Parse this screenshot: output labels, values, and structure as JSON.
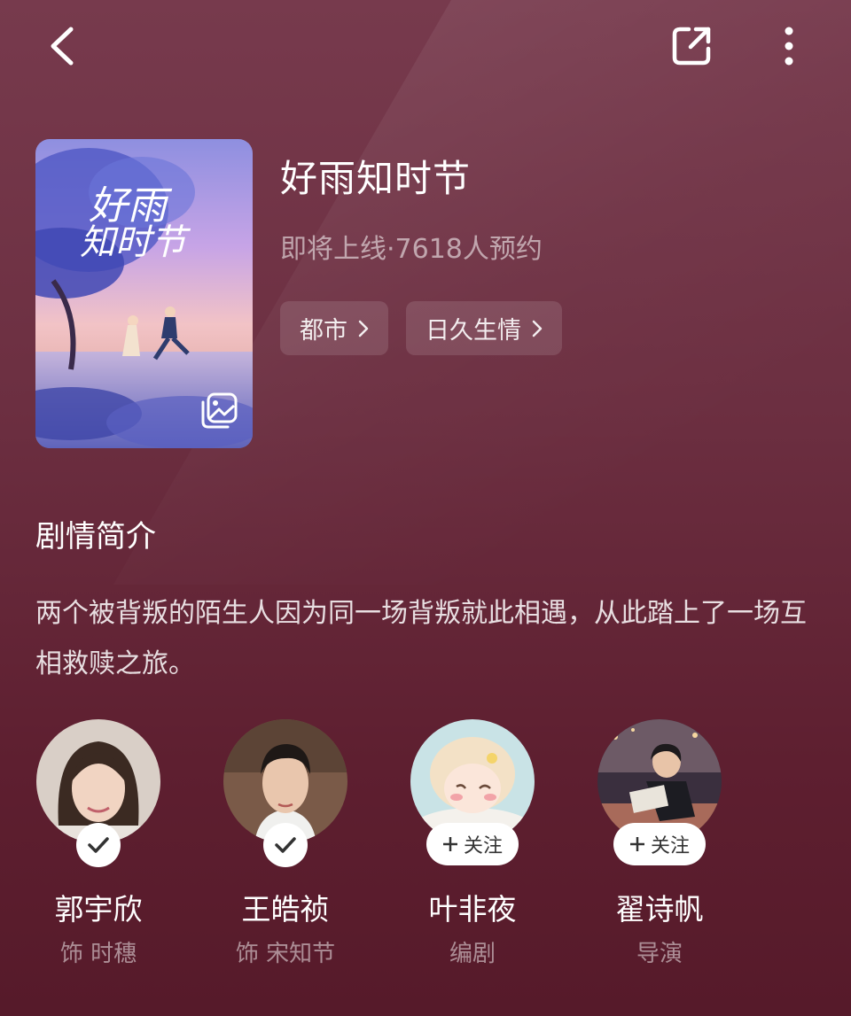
{
  "header": {
    "back_icon": "chevron-left-icon",
    "share_icon": "share-external-icon",
    "more_icon": "more-vertical-icon"
  },
  "poster": {
    "art_title_text": "好雨知时节",
    "gallery_icon": "gallery-icon"
  },
  "show": {
    "title": "好雨知时节",
    "meta": "即将上线·7618人预约",
    "tags": [
      {
        "label": "都市"
      },
      {
        "label": "日久生情"
      }
    ]
  },
  "synopsis": {
    "heading": "剧情简介",
    "text": "两个被背叛的陌生人因为同一场背叛就此相遇，从此踏上了一场互相救赎之旅。"
  },
  "people": [
    {
      "name": "郭宇欣",
      "role": "饰 时穗",
      "status": "followed"
    },
    {
      "name": "王皓祯",
      "role": "饰 宋知节",
      "status": "followed"
    },
    {
      "name": "叶非夜",
      "role": "编剧",
      "status": "follow",
      "follow_label": "关注"
    },
    {
      "name": "翟诗帆",
      "role": "导演",
      "status": "follow",
      "follow_label": "关注"
    }
  ],
  "colors": {
    "background_top": "#773a4d",
    "background_bottom": "#561a2a",
    "tag_bg": "rgba(255,255,255,0.12)"
  }
}
